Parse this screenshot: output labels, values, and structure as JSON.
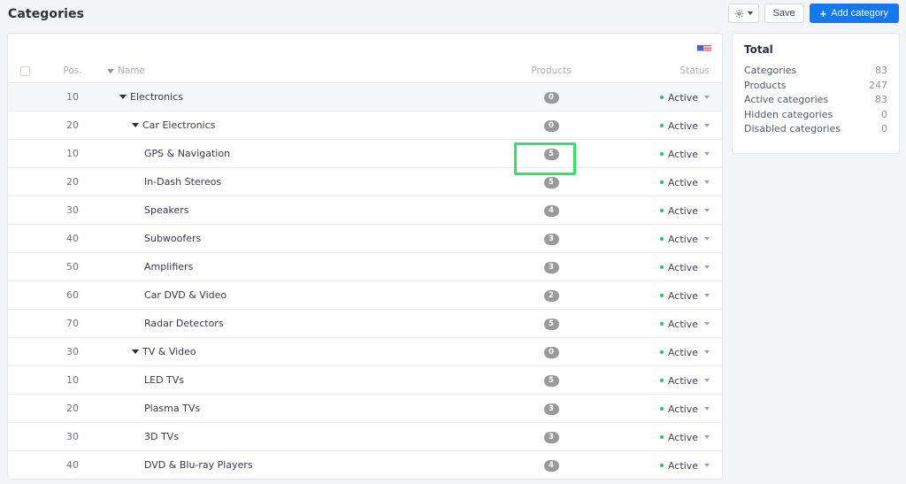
{
  "header": {
    "title": "Categories",
    "settings_button": {
      "icon": "gear-icon",
      "caret": "chevron-down-icon"
    },
    "save_label": "Save",
    "add_label": "Add category",
    "add_icon": "plus-icon",
    "accent_color": "#1478f0"
  },
  "table_card": {
    "language_flag": "us-flag-icon",
    "columns": {
      "check": "",
      "position": "Pos.",
      "name": "Name",
      "products": "Products",
      "status": "Status"
    },
    "sort": {
      "column": "Name",
      "icon": "sort-desc-icon"
    },
    "rows": [
      {
        "pos": "10",
        "name": "Electronics",
        "indent": 0,
        "expandable": true,
        "products": "0",
        "status": "Active",
        "highlighted_row": true
      },
      {
        "pos": "20",
        "name": "Car Electronics",
        "indent": 1,
        "expandable": true,
        "products": "0",
        "status": "Active",
        "highlighted_row": false
      },
      {
        "pos": "10",
        "name": "GPS & Navigation",
        "indent": 2,
        "expandable": false,
        "products": "5",
        "status": "Active",
        "highlighted_row": false
      },
      {
        "pos": "20",
        "name": "In-Dash Stereos",
        "indent": 2,
        "expandable": false,
        "products": "5",
        "status": "Active",
        "highlighted_row": false
      },
      {
        "pos": "30",
        "name": "Speakers",
        "indent": 2,
        "expandable": false,
        "products": "4",
        "status": "Active",
        "highlighted_row": false
      },
      {
        "pos": "40",
        "name": "Subwoofers",
        "indent": 2,
        "expandable": false,
        "products": "3",
        "status": "Active",
        "highlighted_row": false
      },
      {
        "pos": "50",
        "name": "Amplifiers",
        "indent": 2,
        "expandable": false,
        "products": "3",
        "status": "Active",
        "highlighted_row": false
      },
      {
        "pos": "60",
        "name": "Car DVD & Video",
        "indent": 2,
        "expandable": false,
        "products": "2",
        "status": "Active",
        "highlighted_row": false
      },
      {
        "pos": "70",
        "name": "Radar Detectors",
        "indent": 2,
        "expandable": false,
        "products": "5",
        "status": "Active",
        "highlighted_row": false
      },
      {
        "pos": "30",
        "name": "TV & Video",
        "indent": 1,
        "expandable": true,
        "products": "0",
        "status": "Active",
        "highlighted_row": false
      },
      {
        "pos": "10",
        "name": "LED TVs",
        "indent": 2,
        "expandable": false,
        "products": "5",
        "status": "Active",
        "highlighted_row": false
      },
      {
        "pos": "20",
        "name": "Plasma TVs",
        "indent": 2,
        "expandable": false,
        "products": "3",
        "status": "Active",
        "highlighted_row": false
      },
      {
        "pos": "30",
        "name": "3D TVs",
        "indent": 2,
        "expandable": false,
        "products": "3",
        "status": "Active",
        "highlighted_row": false
      },
      {
        "pos": "40",
        "name": "DVD & Blu-ray Players",
        "indent": 2,
        "expandable": false,
        "products": "4",
        "status": "Active",
        "highlighted_row": false
      }
    ],
    "focus_highlight": {
      "target": "products-badge-row-3",
      "color": "#33e06a"
    }
  },
  "total_panel": {
    "title": "Total",
    "stats": [
      {
        "label": "Categories",
        "value": "83"
      },
      {
        "label": "Products",
        "value": "247"
      },
      {
        "label": "Active categories",
        "value": "83"
      },
      {
        "label": "Hidden categories",
        "value": "0"
      },
      {
        "label": "Disabled categories",
        "value": "0"
      }
    ]
  }
}
